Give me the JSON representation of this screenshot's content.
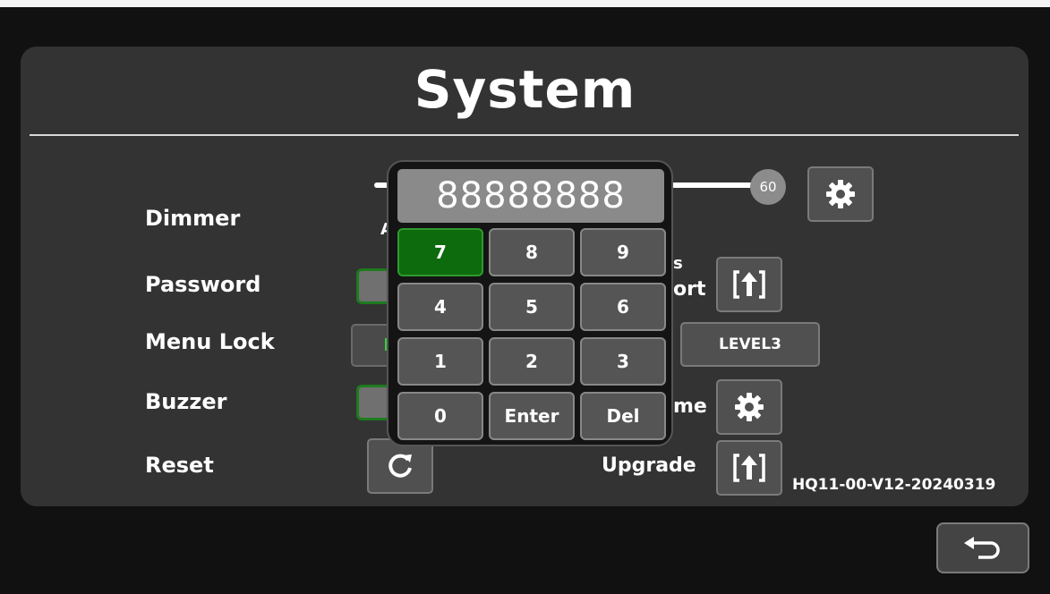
{
  "page": {
    "title": "System"
  },
  "settings": {
    "dimmer": {
      "label": "Dimmer",
      "value": "60",
      "stub_text": "A"
    },
    "password": {
      "label": "Password"
    },
    "menu_lock": {
      "label": "Menu Lock"
    },
    "buzzer": {
      "label": "Buzzer"
    },
    "reset": {
      "label": "Reset",
      "icon": "refresh-icon"
    },
    "export": {
      "label_partial": "ort",
      "label_top_partial": "s",
      "icon": "export-icon"
    },
    "level": {
      "value": "LEVEL3"
    },
    "time": {
      "label_partial": "me",
      "icon": "gear-icon"
    },
    "upgrade": {
      "label": "Upgrade",
      "icon": "upload-icon"
    },
    "dimmer_settings": {
      "icon": "gear-icon"
    }
  },
  "version": "HQ11-00-V12-20240319",
  "keypad": {
    "display_value": "88888888",
    "keys": [
      "7",
      "8",
      "9",
      "4",
      "5",
      "6",
      "1",
      "2",
      "3",
      "0",
      "Enter",
      "Del"
    ],
    "active_key": "7"
  },
  "footer": {
    "back_icon": "back-arrow-icon"
  },
  "colors": {
    "panel": "#333333",
    "active_key": "#0d6b0d",
    "background": "#111111"
  }
}
